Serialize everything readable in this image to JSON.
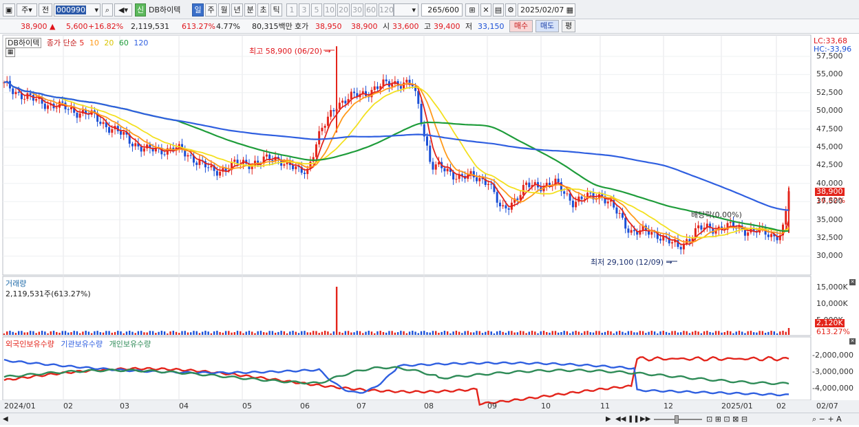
{
  "toolbar": {
    "period_main": "주",
    "prev_label": "전",
    "stock_code": "000990",
    "credit_badge": "신",
    "stock_name": "DB하이텍",
    "period_buttons": [
      "일",
      "주",
      "월",
      "년",
      "분",
      "초",
      "틱"
    ],
    "interval_buttons": [
      "1",
      "3",
      "5",
      "10",
      "20",
      "30",
      "60",
      "120"
    ],
    "count_value": "265",
    "count_max": "/600",
    "date_value": "2025/02/07"
  },
  "quote": {
    "price": "38,900",
    "change": "5,600",
    "change_pct": "+16.82%",
    "volume": "2,119,531",
    "volume_ratio": "613.27%",
    "turnover": "4.77%",
    "amount": "80,315백만",
    "bid_label": "호가",
    "bid1": "38,950",
    "bid2": "38,900",
    "open_label": "시",
    "open": "33,600",
    "high_label": "고",
    "high": "39,400",
    "low_label": "저",
    "low": "33,150",
    "buy_label": "매수",
    "sell_label": "매도",
    "eval_label": "평"
  },
  "price_panel": {
    "title": "DB하이텍",
    "ma_label": "종가 단순",
    "ma_periods": [
      "5",
      "10",
      "20",
      "60",
      "120"
    ],
    "lc": "LC:33,68",
    "hc": "HC:-33,96",
    "high_marker": "최고 58,900 (06/20)",
    "low_marker": "최저 29,100 (12/09)",
    "dividend_marker": "배당락(0.00%)",
    "last_price_tag": "38,900",
    "last_pct_tag": "16.82%",
    "y_ticks": [
      "57,500",
      "55,000",
      "52,500",
      "50,000",
      "47,500",
      "45,000",
      "42,500",
      "40,000",
      "37,500",
      "35,000",
      "32,500",
      "30,000"
    ]
  },
  "volume_panel": {
    "title": "거래량",
    "value": "2,119,531주(613.27%)",
    "y_ticks": [
      "15,000K",
      "10,000K",
      "5,000K"
    ],
    "last_tag": "2,120K",
    "last_pct": "613.27%"
  },
  "holdings_panel": {
    "series_labels": [
      "외국인보유수량",
      "기관보유수량",
      "개인보유수량"
    ],
    "y_ticks": [
      "-2,000,000",
      "-3,000,000",
      "-4,000,000"
    ]
  },
  "x_axis": {
    "labels": [
      "2024/01",
      "02",
      "03",
      "04",
      "05",
      "06",
      "07",
      "08",
      "09",
      "10",
      "11",
      "12",
      "2025/01",
      "02"
    ],
    "right_label": "02/07"
  },
  "colors": {
    "ma5": "#e3241b",
    "ma10": "#ff9a1a",
    "ma20": "#f3e01f",
    "ma60": "#1e9c3a",
    "ma120": "#2f5fe0",
    "up": "#e3241b",
    "down": "#1a4fd6",
    "foreign": "#e3241b",
    "institution": "#2f5fe0",
    "individual": "#2e8b57"
  }
}
